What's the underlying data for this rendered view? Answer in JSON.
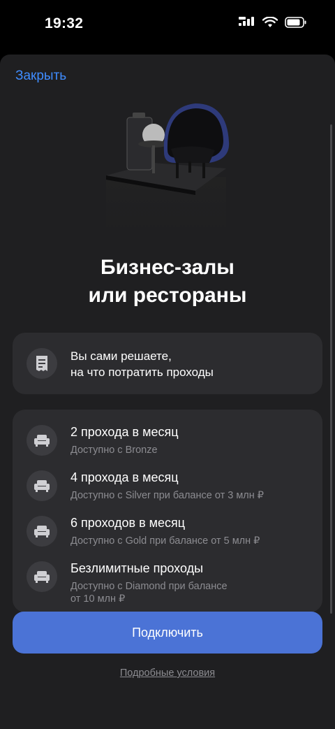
{
  "status": {
    "time": "19:32"
  },
  "sheet": {
    "close_label": "Закрыть",
    "title_line1": "Бизнес-залы",
    "title_line2": "или рестораны",
    "intro": {
      "line1": "Вы сами решаете,",
      "line2": "на что потратить проходы",
      "icon": "receipt-icon"
    },
    "items": [
      {
        "title": "2 прохода в месяц",
        "subtitle": "Доступно с Bronze",
        "icon": "sofa-icon"
      },
      {
        "title": "4 прохода в месяц",
        "subtitle": "Доступно с Silver при балансе от 3 млн ₽",
        "icon": "sofa-icon"
      },
      {
        "title": "6 проходов в месяц",
        "subtitle": "Доступно с Gold при балансе от 5 млн ₽",
        "icon": "sofa-icon"
      },
      {
        "title": "Безлимитные проходы",
        "subtitle_line1": "Доступно с Diamond при балансе",
        "subtitle_line2": "от 10 млн ₽",
        "icon": "sofa-icon"
      }
    ],
    "cta_label": "Подключить",
    "terms_label": "Подробные условия"
  },
  "colors": {
    "accent": "#4b73d6",
    "link": "#3f8cff",
    "sheet_bg": "#1f1f21",
    "card_bg": "#2c2c2f"
  }
}
